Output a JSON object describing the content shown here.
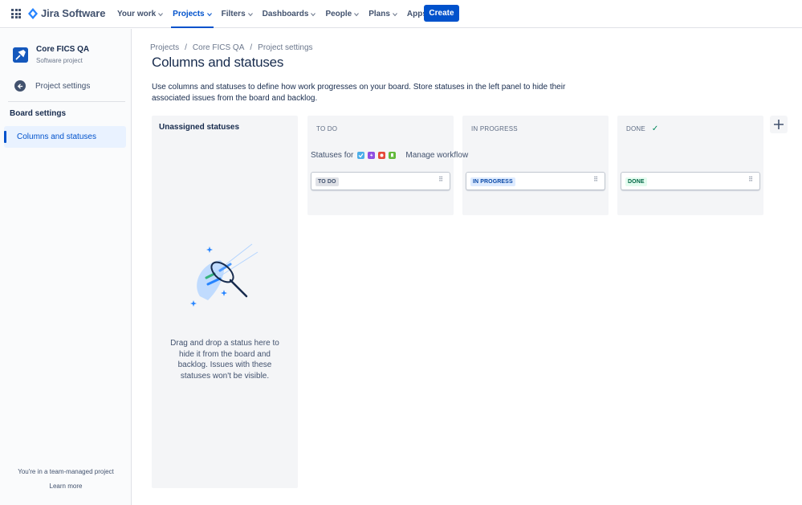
{
  "nav": {
    "logo_text": "Jira Software",
    "items": [
      {
        "label": "Your work"
      },
      {
        "label": "Projects"
      },
      {
        "label": "Filters"
      },
      {
        "label": "Dashboards"
      },
      {
        "label": "People"
      },
      {
        "label": "Plans"
      },
      {
        "label": "Apps"
      }
    ],
    "active_item": "Projects",
    "create_label": "Create",
    "accent": "#0052CC"
  },
  "sidebar": {
    "project_name": "Core FICS QA",
    "project_type": "Software project",
    "back_label": "Project settings",
    "section_label": "Board settings",
    "active_item": "Columns and statuses",
    "team_note": "You're in a team-managed project",
    "learn_more": "Learn more"
  },
  "main": {
    "breadcrumb": [
      "Projects",
      "Core FICS QA",
      "Project settings"
    ],
    "title": "Columns and statuses",
    "description": "Use columns and statuses to define how work progresses on your board. Store statuses in the left panel to hide their associated issues from the board and backlog.",
    "unassigned": {
      "title": "Unassigned statuses",
      "empty_text": "Drag and drop a status here to hide it from the board and backlog. Issues with these statuses won't be visible."
    },
    "statuses_for_label": "Statuses for",
    "issue_type_icons": [
      "task-icon",
      "subtask-icon",
      "bug-icon",
      "story-icon"
    ],
    "manage_workflow": "Manage workflow",
    "columns": [
      {
        "name": "TO DO",
        "status": "TO DO",
        "status_color": "#DFE1E6",
        "status_text_color": "#42526E",
        "done_check": false
      },
      {
        "name": "IN PROGRESS",
        "status": "IN PROGRESS",
        "status_color": "#DEEBFF",
        "status_text_color": "#0747A6",
        "done_check": false
      },
      {
        "name": "DONE",
        "status": "DONE",
        "status_color": "#E3FCEF",
        "status_text_color": "#006644",
        "done_check": true
      }
    ]
  }
}
